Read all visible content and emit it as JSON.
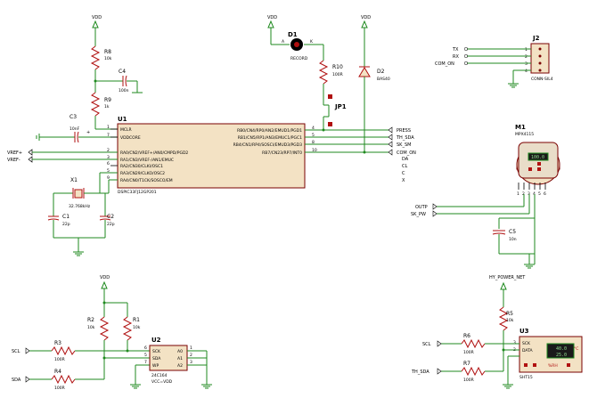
{
  "power": {
    "vdd": "VDD"
  },
  "r8": {
    "ref": "R8",
    "value": "10k"
  },
  "r9": {
    "ref": "R9",
    "value": "1k"
  },
  "c4": {
    "ref": "C4",
    "value": "100n"
  },
  "c3": {
    "ref": "C3",
    "value": "10nF"
  },
  "u1": {
    "ref": "U1",
    "part": "DSPIC33FJ12GP201",
    "left_pins": [
      "MCLR",
      "VDDCORE",
      "RA0/CN2/VREF+/AN0/CMPD/PGD2",
      "RA1/CN3/VREF-/AN1/EMUC",
      "RA2/CN30/CLKI/OSC1",
      "RA3/CN29/CLKO/OSC2",
      "RA4/CN0/T1CK/SOSCO/EM"
    ],
    "left_nums": [
      "1",
      "7",
      "2",
      "3",
      "6",
      "5",
      "9"
    ],
    "right_pins": [
      "RB0/CN4/RP0/AN2/EMUD1/PGD1",
      "RB1/CN5/RP1/AN3/EMUC1/PGC1",
      "RB4/CN1/RP4/SOSCI/EMUD3/PGD3",
      "RB7/CN23/RP7/INT0"
    ],
    "right_nums": [
      "4",
      "5",
      "8",
      "10"
    ]
  },
  "net_labels": {
    "vref_plus": "VREF+",
    "vref_minus": "VREF-",
    "press": "PRESS",
    "th_sda": "TH_SDA",
    "sk_sm": "SK_SM",
    "com_on": "COM_ON",
    "da": "DA",
    "cl": "CL",
    "c": "C",
    "x": "X"
  },
  "x1": {
    "ref": "X1",
    "value": "32.768kHz"
  },
  "c1": {
    "ref": "C1",
    "value": "22p"
  },
  "c2": {
    "ref": "C2",
    "value": "22p"
  },
  "d1": {
    "ref": "D1",
    "value": "RECORD",
    "a": "A",
    "k": "K"
  },
  "r10": {
    "ref": "R10",
    "value": "100R"
  },
  "jp1": {
    "ref": "JP1"
  },
  "d2": {
    "ref": "D2",
    "value": "BAS40"
  },
  "j2": {
    "ref": "J2",
    "value": "CONN-SIL4",
    "pins": [
      "TX",
      "RX",
      "COM_ON"
    ],
    "nums": [
      "1",
      "2",
      "3",
      "4"
    ]
  },
  "m1": {
    "ref": "M1",
    "value": "MPX4115",
    "readout": "100.0",
    "pins": [
      "1",
      "2",
      "3",
      "4",
      "5",
      "6"
    ]
  },
  "m1_nets": {
    "outp": "OUTP",
    "sk_pw": "SK_PW"
  },
  "c5": {
    "ref": "C5",
    "value": "10n"
  },
  "hy_power": "HY_POWER_NET",
  "r1": {
    "ref": "R1",
    "value": "10k"
  },
  "r2": {
    "ref": "R2",
    "value": "10k"
  },
  "r3": {
    "ref": "R3",
    "value": "100R"
  },
  "r4": {
    "ref": "R4",
    "value": "100R"
  },
  "u2": {
    "ref": "U2",
    "part": "24C164",
    "supply": "VCC=VDD",
    "pins_left": [
      "SCK",
      "SDA",
      "WP"
    ],
    "pins_right": [
      "A0",
      "A1",
      "A2"
    ],
    "nums_left": [
      "6",
      "5",
      "7"
    ],
    "nums_right": [
      "1",
      "2",
      "3"
    ]
  },
  "scl": "SCL",
  "sda": "SDA",
  "r5": {
    "ref": "R5",
    "value": "10k"
  },
  "r6": {
    "ref": "R6",
    "value": "100R"
  },
  "r7": {
    "ref": "R7",
    "value": "100R"
  },
  "u3": {
    "ref": "U3",
    "part": "SHT15",
    "pins": [
      "SCK",
      "DATA"
    ],
    "nums": [
      "3",
      "2"
    ],
    "temp": "40.0",
    "hum": "25.0",
    "rh": "%RH",
    "deg": "°C"
  },
  "th_sda_low": "TH_SDA",
  "scl_low": "SCL",
  "colors": {
    "wire": "#1f8a1f",
    "component": "#b01010",
    "body": "#f3e2c4"
  }
}
